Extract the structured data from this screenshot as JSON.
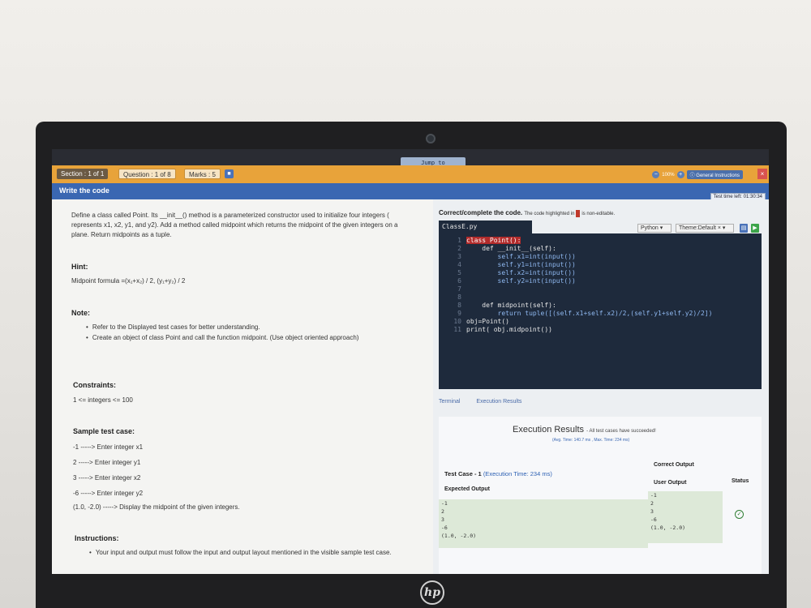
{
  "header": {
    "section": "Section : 1 of 1",
    "question": "Question : 1 of 8",
    "marks": "Marks : 5",
    "jump_to": "Jump to",
    "zoom": "100%",
    "general_instructions": "General Instructions",
    "close": "×",
    "title": "Write the code",
    "time_left": "Test time left: 01:30:34"
  },
  "problem": {
    "description": "Define a class called Point. Its __init__() method is a parameterized constructor used to initialize four integers ( represents x1, x2, y1, and y2). Add a method called midpoint which returns the midpoint of the given integers on a plane. Return midpoints as a tuple.",
    "hint_label": "Hint:",
    "hint": "Midpoint formula =(x₁+x₂) / 2, (y₁+y₂) / 2",
    "note_label": "Note:",
    "notes": [
      "Refer to the Displayed test cases for better understanding.",
      "Create an object of class Point and call the function midpoint. (Use object oriented approach)"
    ],
    "constraints_label": "Constraints:",
    "constraints": "1 <= integers <= 100",
    "sample_label": "Sample test case:",
    "sample_lines": [
      "-1 -----> Enter integer x1",
      "2 -----> Enter integer y1",
      "3 -----> Enter integer x2",
      "-6 -----> Enter integer y2",
      "(1.0, -2.0) -----> Display the midpoint of the given integers."
    ],
    "instructions_label": "Instructions:",
    "instructions": [
      "Your input and output must follow the input and output layout mentioned in the visible sample test case."
    ]
  },
  "editor": {
    "heading": "Correct/complete the code.",
    "note_before": "The code highlighted in",
    "note_after": "is non-editable.",
    "filename": "ClassE.py",
    "language": "Python",
    "theme": "Theme:Default",
    "code_lines": [
      "class Point():",
      "    def __init__(self):",
      "        self.x1=int(input())",
      "        self.y1=int(input())",
      "        self.x2=int(input())",
      "        self.y2=int(input())",
      "",
      "",
      "    def midpoint(self):",
      "        return tuple([(self.x1+self.x2)/2,(self.y1+self.y2)/2])",
      "obj=Point()",
      "print( obj.midpoint())"
    ]
  },
  "results": {
    "tab_terminal": "Terminal",
    "tab_execution": "Execution Results",
    "title": "Execution Results",
    "subtitle": "- All test cases have succeeded!",
    "avg": "(Avg. Time: 140.7 ms , Max. Time: 234 ms)",
    "testcase_label": "Test Case - 1",
    "testcase_time": "(Execution Time: 234 ms)",
    "expected_label": "Expected Output",
    "correct_label": "Correct Output",
    "user_label": "User Output",
    "status_label": "Status",
    "expected_lines": [
      "-1",
      "2",
      "3",
      "-6",
      "(1.0, -2.0)"
    ],
    "user_lines": [
      "-1",
      "2",
      "3",
      "-6",
      "(1.0, -2.0)"
    ]
  }
}
